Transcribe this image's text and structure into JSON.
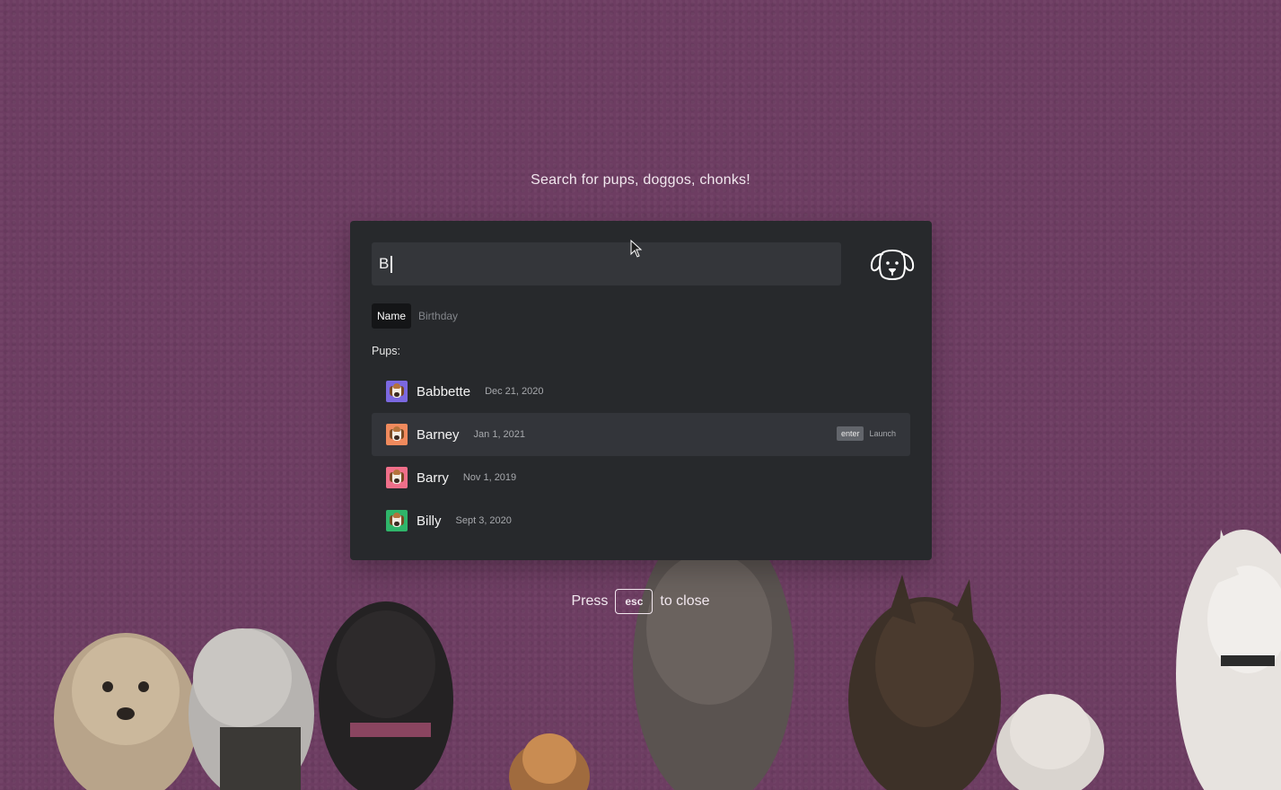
{
  "headline": "Search for pups, doggos, chonks!",
  "search": {
    "value": "B"
  },
  "tabs": [
    {
      "label": "Name",
      "active": true
    },
    {
      "label": "Birthday",
      "active": false
    }
  ],
  "section_label": "Pups:",
  "results": [
    {
      "name": "Babbette",
      "date": "Dec 21, 2020",
      "avatar_bg": "#7b68e0"
    },
    {
      "name": "Barney",
      "date": "Jan 1, 2021",
      "avatar_bg": "#f08a5d",
      "selected": true
    },
    {
      "name": "Barry",
      "date": "Nov 1, 2019",
      "avatar_bg": "#f06f8a"
    },
    {
      "name": "Billy",
      "date": "Sept 3, 2020",
      "avatar_bg": "#2fb56a"
    }
  ],
  "selected_hint": {
    "key": "enter",
    "action": "Launch"
  },
  "footer": {
    "before": "Press",
    "key": "esc",
    "after": "to close"
  },
  "colors": {
    "background": "#6d3d62",
    "panel": "#27292c",
    "input": "#34363a",
    "selected_row": "#33353a"
  }
}
